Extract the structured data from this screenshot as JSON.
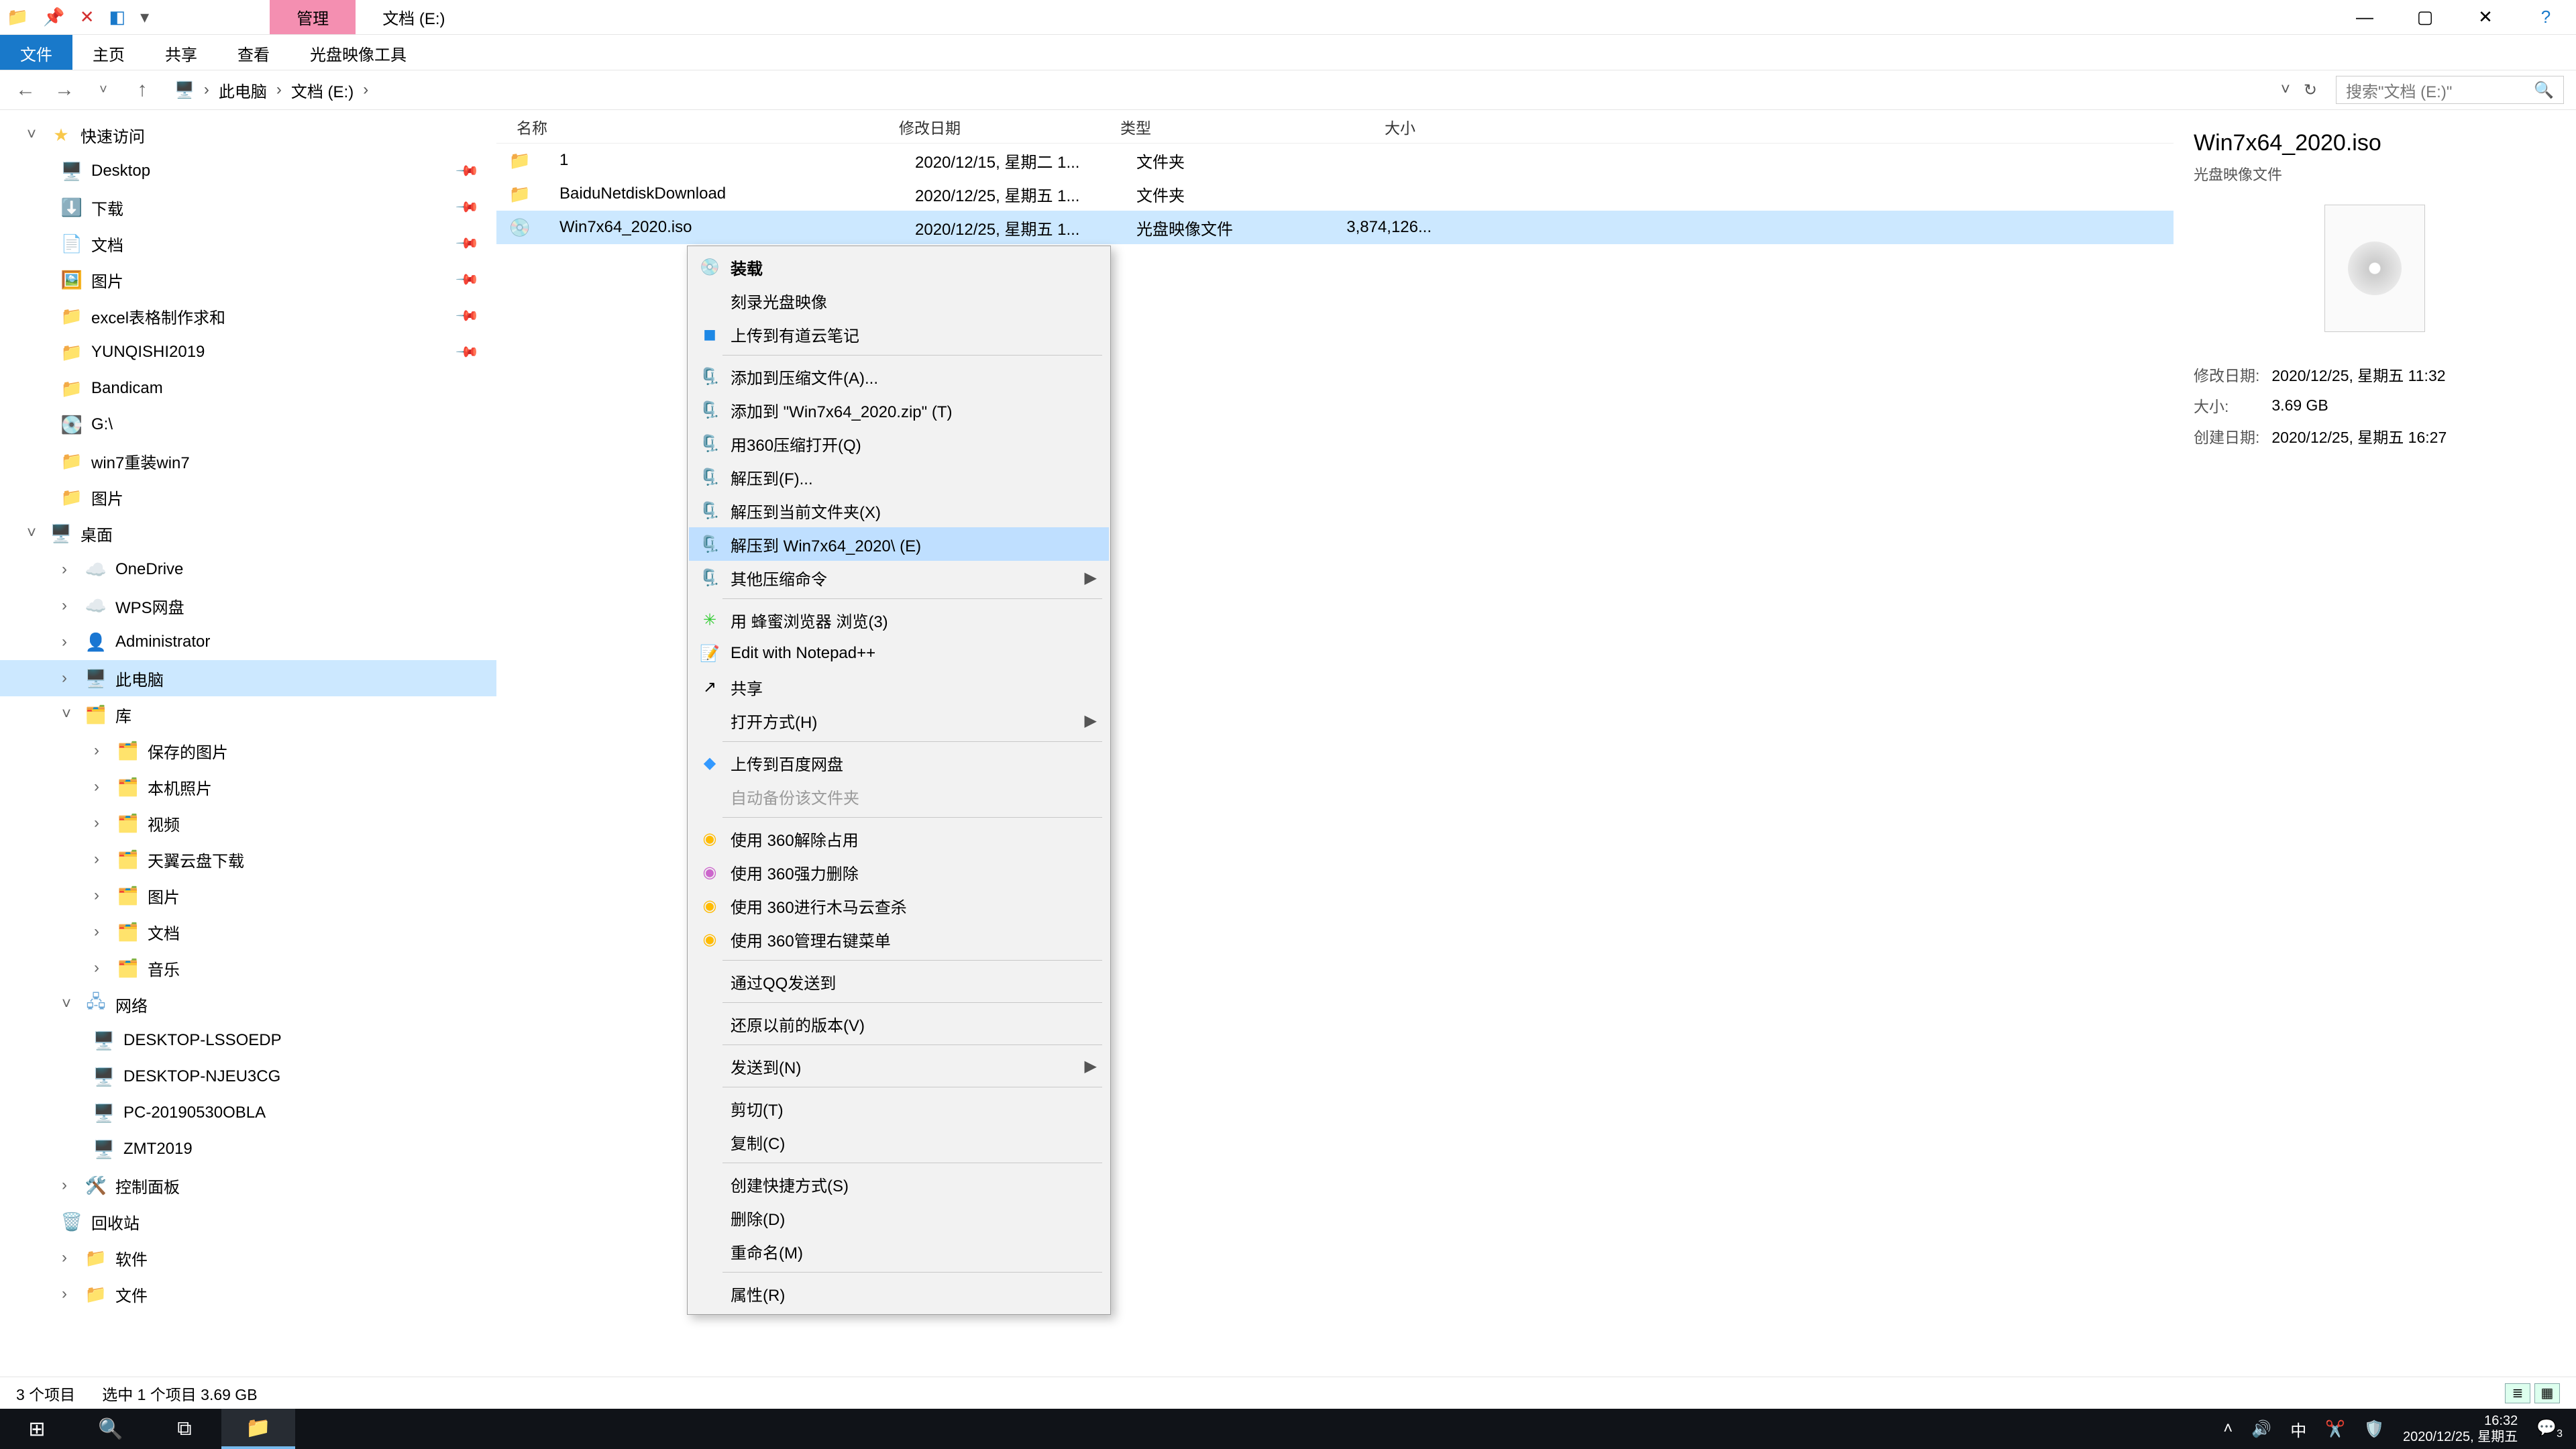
{
  "titlebar": {
    "tab_active": "管理",
    "tab_title": "文档 (E:)"
  },
  "ribbon": {
    "file": "文件",
    "home": "主页",
    "share": "共享",
    "view": "查看",
    "disc_tools": "光盘映像工具"
  },
  "breadcrumb": {
    "pc": "此电脑",
    "drive": "文档 (E:)"
  },
  "search": {
    "placeholder": "搜索\"文档 (E:)\""
  },
  "sidebar": {
    "quick": "快速访问",
    "desktop": "Desktop",
    "downloads": "下载",
    "documents": "文档",
    "pictures": "图片",
    "excel": "excel表格制作求和",
    "yunqishi": "YUNQISHI2019",
    "bandicam": "Bandicam",
    "g_drive": "G:\\",
    "win7": "win7重装win7",
    "pictures2": "图片",
    "desktop2": "桌面",
    "onedrive": "OneDrive",
    "wps": "WPS网盘",
    "admin": "Administrator",
    "thispc": "此电脑",
    "libraries": "库",
    "saved_pic": "保存的图片",
    "local_pic": "本机照片",
    "videos_lib": "视频",
    "tianyi": "天翼云盘下载",
    "pictures_lib": "图片",
    "documents_lib": "文档",
    "music_lib": "音乐",
    "network": "网络",
    "pc1": "DESKTOP-LSSOEDP",
    "pc2": "DESKTOP-NJEU3CG",
    "pc3": "PC-20190530OBLA",
    "pc4": "ZMT2019",
    "control": "控制面板",
    "recycle": "回收站",
    "software": "软件",
    "files": "文件"
  },
  "columns": {
    "name": "名称",
    "date": "修改日期",
    "type": "类型",
    "size": "大小"
  },
  "rows": [
    {
      "name": "1",
      "date": "2020/12/15, 星期二 1...",
      "type": "文件夹",
      "size": ""
    },
    {
      "name": "BaiduNetdiskDownload",
      "date": "2020/12/25, 星期五 1...",
      "type": "文件夹",
      "size": ""
    },
    {
      "name": "Win7x64_2020.iso",
      "date": "2020/12/25, 星期五 1...",
      "type": "光盘映像文件",
      "size": "3,874,126..."
    }
  ],
  "context_menu": {
    "mount": "装载",
    "burn": "刻录光盘映像",
    "youdao": "上传到有道云笔记",
    "add_archive": "添加到压缩文件(A)...",
    "add_zip": "添加到 \"Win7x64_2020.zip\" (T)",
    "open_360": "用360压缩打开(Q)",
    "extract_to": "解压到(F)...",
    "extract_here": "解压到当前文件夹(X)",
    "extract_named": "解压到 Win7x64_2020\\ (E)",
    "other_compress": "其他压缩命令",
    "bee_browser": "用 蜂蜜浏览器 浏览(3)",
    "notepadpp": "Edit with Notepad++",
    "share": "共享",
    "open_with": "打开方式(H)",
    "baidu_upload": "上传到百度网盘",
    "auto_backup": "自动备份该文件夹",
    "unlock_360": "使用 360解除占用",
    "force_del_360": "使用 360强力删除",
    "trojan_360": "使用 360进行木马云查杀",
    "menu_360": "使用 360管理右键菜单",
    "qq_send": "通过QQ发送到",
    "restore_prev": "还原以前的版本(V)",
    "send_to": "发送到(N)",
    "cut": "剪切(T)",
    "copy": "复制(C)",
    "shortcut": "创建快捷方式(S)",
    "delete": "删除(D)",
    "rename": "重命名(M)",
    "properties": "属性(R)"
  },
  "details": {
    "title": "Win7x64_2020.iso",
    "subtitle": "光盘映像文件",
    "mod_label": "修改日期:",
    "mod_val": "2020/12/25, 星期五 11:32",
    "size_label": "大小:",
    "size_val": "3.69 GB",
    "created_label": "创建日期:",
    "created_val": "2020/12/25, 星期五 16:27"
  },
  "status": {
    "items": "3 个项目",
    "selected": "选中 1 个项目  3.69 GB"
  },
  "taskbar": {
    "ime": "中",
    "time": "16:32",
    "date": "2020/12/25, 星期五",
    "badge": "3"
  }
}
